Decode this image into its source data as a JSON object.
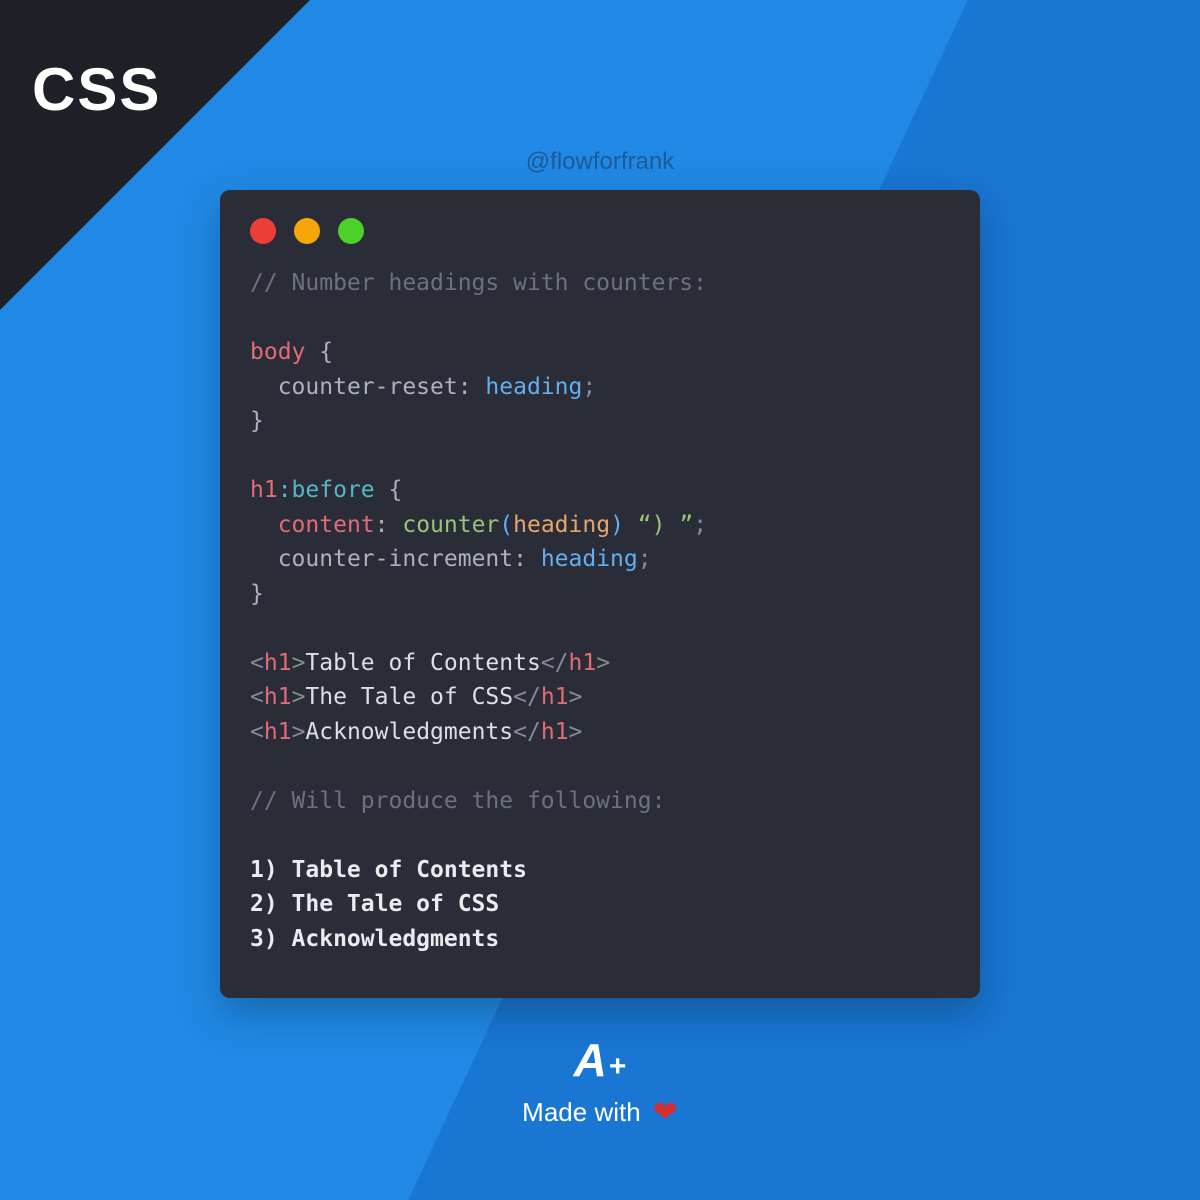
{
  "corner": {
    "label": "CSS"
  },
  "handle": "@flowforfrank",
  "code": {
    "comment1": "// Number headings with counters:",
    "sel1": "body",
    "brace_open": " {",
    "brace_close": "}",
    "prop1": "counter-reset",
    "val1": "heading",
    "semi": ";",
    "colon": ": ",
    "sel2": "h1",
    "pseudo": ":before",
    "prop2a": "content",
    "func": "counter",
    "paren_open": "(",
    "paren_close": ")",
    "arg": "heading",
    "string_suffix": " “) ”",
    "prop2b": "counter-increment",
    "val2b": "heading",
    "tag_open": "<",
    "tag_name": "h1",
    "tag_gt": ">",
    "tag_close_open": "</",
    "h1_text_1": "Table of Contents",
    "h1_text_2": "The Tale of CSS",
    "h1_text_3": "Acknowledgments",
    "comment2": "// Will produce the following:",
    "output_1": "1) Table of Contents",
    "output_2": "2) The Tale of CSS",
    "output_3": "3) Acknowledgments"
  },
  "footer": {
    "logo_a": "A",
    "logo_plus": "+",
    "made_with": "Made with",
    "heart": "❤"
  }
}
